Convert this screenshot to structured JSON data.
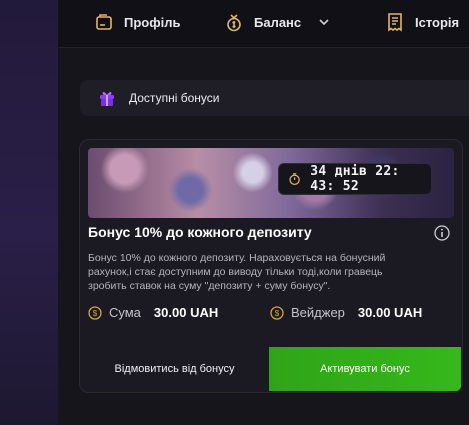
{
  "nav": {
    "profile": "Профіль",
    "balance": "Баланс",
    "history": "Історія"
  },
  "bonuses_bar": {
    "label": "Доступні бонуси"
  },
  "bonus_card": {
    "timer": "34 днів 22: 43: 52",
    "title": "Бонус 10% до кожного депозиту",
    "description": "Бонус 10% до кожного депозиту. Нараховується на бонусний рахунок,і стає доступним до виводу тільки тоді,коли гравець зробить ставок на суму \"депозиту + суму бонусу\".",
    "amount_label": "Сума",
    "amount_value": "30.00 UAH",
    "wager_label": "Вейджер",
    "wager_value": "30.00 UAH",
    "decline_label": "Відмовитись від бонусу",
    "activate_label": "Активувати бонус"
  },
  "colors": {
    "accent_green": "#36b81a",
    "gift_purple": "#8b3dff",
    "coin_gold": "#d4a53c"
  },
  "icons": [
    "profile-icon",
    "wallet-icon",
    "chevron-down-icon",
    "receipt-icon",
    "gift-icon",
    "stopwatch-icon",
    "info-icon",
    "coin-icon"
  ]
}
